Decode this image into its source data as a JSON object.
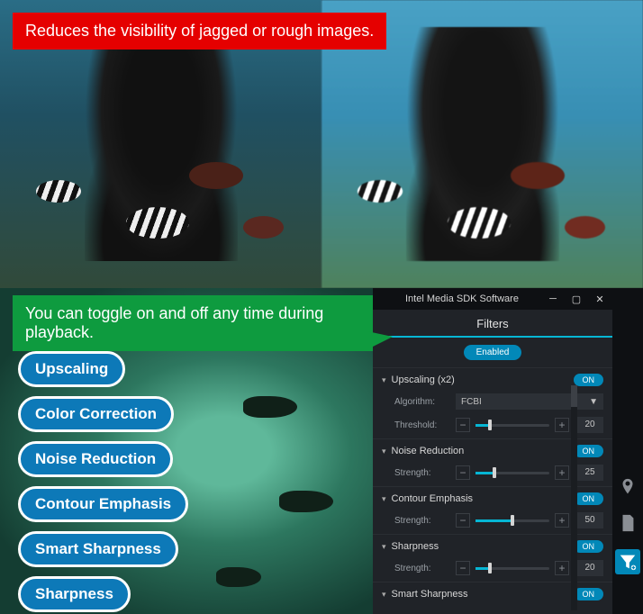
{
  "callouts": {
    "red": "Reduces the visibility of jagged or rough images.",
    "green": "You can toggle on and off any time during playback."
  },
  "pills": [
    "Upscaling",
    "Color Correction",
    "Noise Reduction",
    "Contour Emphasis",
    "Smart Sharpness",
    "Sharpness"
  ],
  "window": {
    "title": "Intel Media SDK Software"
  },
  "panel": {
    "header": "Filters",
    "enabled_label": "Enabled",
    "sections": [
      {
        "title": "Upscaling (x2)",
        "toggle": "ON",
        "rows": [
          {
            "kind": "select",
            "label": "Algorithm:",
            "value": "FCBI"
          },
          {
            "kind": "slider",
            "label": "Threshold:",
            "value": "20",
            "fill_pct": 20
          }
        ]
      },
      {
        "title": "Noise Reduction",
        "toggle": "ON",
        "rows": [
          {
            "kind": "slider",
            "label": "Strength:",
            "value": "25",
            "fill_pct": 25
          }
        ]
      },
      {
        "title": "Contour Emphasis",
        "toggle": "ON",
        "rows": [
          {
            "kind": "slider",
            "label": "Strength:",
            "value": "50",
            "fill_pct": 50
          }
        ]
      },
      {
        "title": "Sharpness",
        "toggle": "ON",
        "rows": [
          {
            "kind": "slider",
            "label": "Strength:",
            "value": "20",
            "fill_pct": 20
          }
        ]
      },
      {
        "title": "Smart Sharpness",
        "toggle": "ON",
        "rows": []
      }
    ]
  }
}
